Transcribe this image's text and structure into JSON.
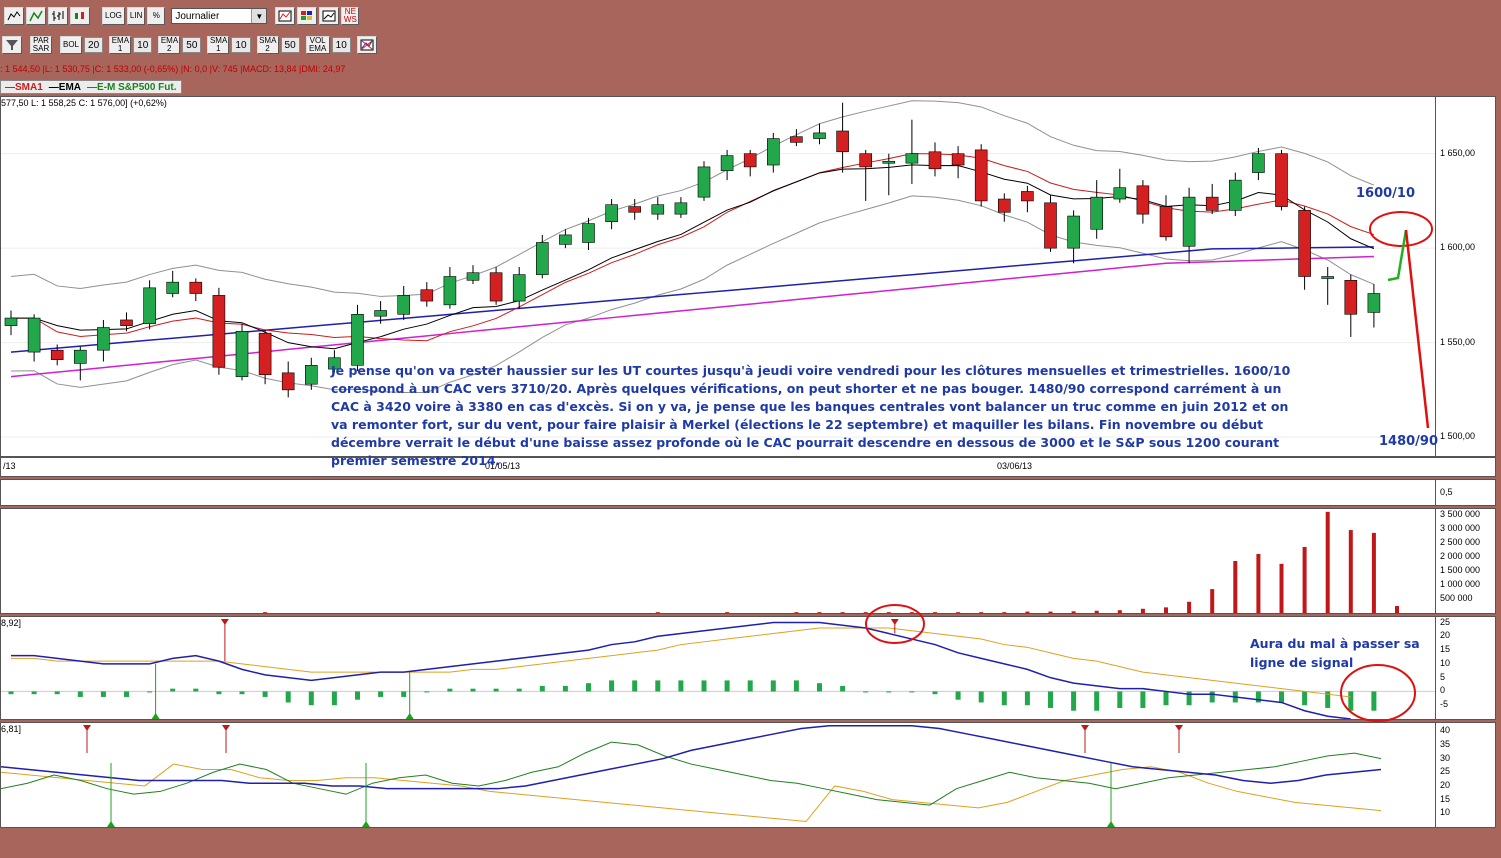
{
  "toolbar1": {
    "buttons": [
      {
        "id": "line-chart",
        "label": ""
      },
      {
        "id": "bar-chart",
        "label": ""
      },
      {
        "id": "ohlc-chart",
        "label": ""
      },
      {
        "id": "candle-chart",
        "label": ""
      }
    ],
    "log_label": "LOG",
    "lin_label": "LIN",
    "pct_label": "%",
    "period_value": "Journalier",
    "news_label": "NE WS"
  },
  "toolbar2": {
    "par_sar": "PAR SAR",
    "bol": "BOL",
    "bol_val": "20",
    "ema1": "EMA 1",
    "ema1_val": "10",
    "ema2": "EMA 2",
    "ema2_val": "50",
    "sma1": "SMA 1",
    "sma1_val": "10",
    "sma2": "SMA 2",
    "sma2_val": "50",
    "vol_ema": "VOL EMA",
    "vol_ema_val": "10"
  },
  "infobar": ": 1 544,50 |L: 1 530,75 |C: 1 533,00 (-0,65%) |N: 0,0 |V: 745 |MACD: 13,84 |DMI: 24,97",
  "legend": {
    "sma1": "SMA1",
    "ema": "EMA",
    "em": "E-M S&P500 Fut."
  },
  "colors": {
    "up": "#22a84a",
    "down": "#d42020",
    "ema": "#000000",
    "sma": "#cc1c1c",
    "ma50": "#1f1fb0",
    "ma50b": "#d020d0",
    "bollinger": "#909090",
    "macd": "#1f1fb0",
    "signal": "#e0a020",
    "annot": "#1f3aa8",
    "circle": "#e01010"
  },
  "price_panel": {
    "title": "577,50   L: 1 558,25   C: 1 576,00] (+0,62%)"
  },
  "dates": [
    "/13",
    "01/05/13",
    "03/06/13"
  ],
  "annotations": {
    "text": "Je pense qu'on va rester haussier sur les UT courtes jusqu'à jeudi voire vendredi pour les clôtures mensuelles et trimestrielles. 1600/10 corespond à un CAC vers 3710/20. Après quelques vérifications, on peut shorter et ne pas bouger. 1480/90 correspond carrément à un CAC à 3420 voire à 3380 en cas d'excès. Si on y va, je pense que les banques centrales vont balancer un truc comme en juin 2012 et on va remonter fort, sur du vent, pour faire plaisir à Merkel (élections le 22 septembre) et maquiller les bilans. Fin novembre ou début décembre verrait le début d'une baisse assez profonde où le CAC pourrait descendre en dessous de 3000 et le S&P sous 1200 courant premier semestre 2014.",
    "target_high": "1600/10",
    "target_low": "1480/90",
    "macd_note": "Aura du mal à passer sa ligne de signal"
  },
  "macd_panel": {
    "title": "8,92]"
  },
  "dmi_panel": {
    "title": "6,81]"
  },
  "chart_data": [
    {
      "type": "candlestick",
      "name": "price",
      "ylim": [
        1490,
        1680
      ],
      "yticks": [
        "1 650,00",
        "1 600,00",
        "1 550,00",
        "1 500,00"
      ],
      "ytick_values": [
        1650,
        1600,
        1550,
        1500
      ],
      "ohlc": [
        [
          1559,
          1563,
          1554,
          1567
        ],
        [
          1545,
          1563,
          1540,
          1565
        ],
        [
          1546,
          1541,
          1538,
          1549
        ],
        [
          1539,
          1546,
          1530,
          1548
        ],
        [
          1546,
          1558,
          1540,
          1562
        ],
        [
          1562,
          1559,
          1556,
          1566
        ],
        [
          1560,
          1579,
          1557,
          1583
        ],
        [
          1576,
          1582,
          1574,
          1588
        ],
        [
          1582,
          1576,
          1572,
          1584
        ],
        [
          1575,
          1537,
          1533,
          1579
        ],
        [
          1532,
          1556,
          1530,
          1560
        ],
        [
          1555,
          1533,
          1528,
          1557
        ],
        [
          1534,
          1525,
          1521,
          1540
        ],
        [
          1528,
          1538,
          1525,
          1542
        ],
        [
          1536,
          1542,
          1534,
          1546
        ],
        [
          1538,
          1565,
          1535,
          1570
        ],
        [
          1564,
          1567,
          1560,
          1572
        ],
        [
          1565,
          1575,
          1562,
          1580
        ],
        [
          1578,
          1572,
          1569,
          1582
        ],
        [
          1570,
          1585,
          1568,
          1590
        ],
        [
          1583,
          1587,
          1581,
          1591
        ],
        [
          1587,
          1572,
          1570,
          1590
        ],
        [
          1572,
          1586,
          1568,
          1590
        ],
        [
          1586,
          1603,
          1584,
          1607
        ],
        [
          1602,
          1607,
          1600,
          1610
        ],
        [
          1603,
          1613,
          1599,
          1616
        ],
        [
          1614,
          1623,
          1610,
          1626
        ],
        [
          1622,
          1619,
          1615,
          1626
        ],
        [
          1618,
          1623,
          1615,
          1627
        ],
        [
          1618,
          1624,
          1616,
          1627
        ],
        [
          1627,
          1643,
          1625,
          1646
        ],
        [
          1641,
          1649,
          1636,
          1652
        ],
        [
          1650,
          1643,
          1638,
          1652
        ],
        [
          1644,
          1658,
          1640,
          1661
        ],
        [
          1659,
          1656,
          1654,
          1663
        ],
        [
          1658,
          1661,
          1655,
          1666
        ],
        [
          1662,
          1651,
          1640,
          1677
        ],
        [
          1650,
          1643,
          1625,
          1652
        ],
        [
          1646,
          1646,
          1628,
          1650
        ],
        [
          1645,
          1650,
          1634,
          1668
        ],
        [
          1651,
          1642,
          1638,
          1656
        ],
        [
          1650,
          1644,
          1637,
          1654
        ],
        [
          1652,
          1625,
          1622,
          1655
        ],
        [
          1626,
          1619,
          1614,
          1629
        ],
        [
          1630,
          1625,
          1619,
          1633
        ],
        [
          1624,
          1600,
          1598,
          1628
        ],
        [
          1600,
          1617,
          1592,
          1620
        ],
        [
          1610,
          1627,
          1605,
          1636
        ],
        [
          1626,
          1632,
          1624,
          1642
        ],
        [
          1633,
          1618,
          1613,
          1636
        ],
        [
          1622,
          1606,
          1604,
          1628
        ],
        [
          1601,
          1627,
          1592,
          1632
        ],
        [
          1627,
          1620,
          1618,
          1634
        ],
        [
          1620,
          1636,
          1617,
          1640
        ],
        [
          1640,
          1650,
          1636,
          1653
        ],
        [
          1650,
          1622,
          1620,
          1652
        ],
        [
          1620,
          1585,
          1578,
          1622
        ],
        [
          1585,
          1585,
          1570,
          1590
        ],
        [
          1583,
          1565,
          1553,
          1586
        ],
        [
          1566,
          1576,
          1558,
          1581
        ]
      ]
    },
    {
      "type": "bar",
      "name": "volume",
      "ylim": [
        0,
        3700000
      ],
      "yticks": [
        "3 500 000",
        "3 000 000",
        "2 500 000",
        "2 000 000",
        "1 500 000",
        "1 000 000",
        "500 000"
      ],
      "ytick_values": [
        3500000,
        3000000,
        2500000,
        2000000,
        1500000,
        1000000,
        500000
      ],
      "values": [
        0,
        0,
        0,
        0,
        0,
        0,
        0,
        0,
        0,
        0,
        0,
        30000,
        0,
        0,
        0,
        0,
        0,
        0,
        0,
        0,
        0,
        0,
        0,
        0,
        0,
        0,
        0,
        0,
        30000,
        0,
        0,
        30000,
        0,
        0,
        30000,
        30000,
        30000,
        30000,
        30000,
        30000,
        30000,
        30000,
        30000,
        30000,
        50000,
        50000,
        60000,
        80000,
        100000,
        150000,
        200000,
        400000,
        850000,
        1850000,
        2100000,
        1750000,
        2350000,
        3600000,
        2950000,
        2850000,
        250000
      ]
    },
    {
      "type": "line",
      "name": "macd",
      "ylim": [
        -10,
        27
      ],
      "yticks": [
        "25",
        "20",
        "15",
        "10",
        "5",
        "0",
        "-5"
      ],
      "ytick_values": [
        25,
        20,
        15,
        10,
        5,
        0,
        -5
      ],
      "macd": [
        13,
        13,
        12,
        11,
        10,
        10,
        10,
        12,
        13,
        11,
        8,
        6,
        5,
        4,
        5,
        6,
        7,
        7,
        8,
        9,
        10,
        11,
        12,
        13,
        14,
        15,
        17,
        18,
        20,
        21,
        22,
        23,
        24,
        25,
        25,
        25,
        24,
        23,
        21,
        19,
        17,
        14,
        12,
        10,
        8,
        5,
        3,
        2,
        1,
        1,
        0,
        -1,
        -1,
        -2,
        -3,
        -4,
        -7,
        -9,
        -10
      ],
      "signal": [
        12,
        12,
        11,
        11,
        11,
        11,
        11,
        11,
        11,
        11,
        10,
        9,
        8,
        7,
        7,
        7,
        7,
        7,
        7,
        7,
        8,
        8,
        9,
        10,
        11,
        12,
        13,
        14,
        15,
        17,
        18,
        19,
        20,
        21,
        22,
        23,
        23,
        23,
        23,
        22,
        21,
        20,
        19,
        17,
        16,
        14,
        12,
        11,
        9,
        7,
        6,
        5,
        4,
        3,
        2,
        1,
        0,
        -1,
        -2
      ],
      "hist": [
        -1,
        -1,
        -1,
        -2,
        -2,
        -2,
        0,
        1,
        1,
        -1,
        -1,
        -2,
        -4,
        -5,
        -5,
        -3,
        -2,
        -2,
        0,
        1,
        1,
        1,
        1,
        2,
        2,
        3,
        4,
        4,
        4,
        4,
        4,
        4,
        4,
        4,
        4,
        3,
        2,
        0,
        0,
        0,
        -1,
        -3,
        -4,
        -5,
        -5,
        -6,
        -7,
        -7,
        -6,
        -6,
        -5,
        -5,
        -4,
        -4,
        -4,
        -4,
        -5,
        -6,
        -7,
        -7
      ]
    },
    {
      "type": "line",
      "name": "dmi",
      "ylim": [
        5,
        43
      ],
      "yticks": [
        "40",
        "35",
        "30",
        "25",
        "20",
        "15",
        "10"
      ],
      "ytick_values": [
        40,
        35,
        30,
        25,
        20,
        15,
        10
      ],
      "adx": [
        27,
        26,
        25,
        24,
        23,
        22,
        22,
        22,
        22,
        21,
        21,
        21,
        20,
        20,
        19,
        19,
        19,
        19,
        19,
        20,
        22,
        24,
        26,
        28,
        30,
        33,
        35,
        37,
        39,
        41,
        42,
        42,
        42,
        42,
        41,
        39,
        37,
        35,
        33,
        31,
        29,
        27,
        26,
        25,
        24,
        22,
        21,
        22,
        24,
        25,
        26
      ],
      "plus_di": [
        19,
        21,
        24,
        22,
        19,
        17,
        18,
        21,
        25,
        28,
        26,
        21,
        19,
        17,
        21,
        23,
        24,
        21,
        20,
        22,
        25,
        27,
        32,
        36,
        35,
        31,
        28,
        26,
        24,
        22,
        21,
        19,
        17,
        15,
        14,
        13,
        19,
        22,
        25,
        23,
        22,
        21,
        19,
        21,
        23,
        24,
        25,
        26,
        27,
        29,
        31,
        32,
        30
      ],
      "minus_di": [
        25,
        24,
        23,
        22,
        21,
        20,
        28,
        26,
        26,
        23,
        22,
        22,
        23,
        23,
        22,
        21,
        20,
        18,
        17,
        16,
        15,
        14,
        13,
        12,
        11,
        10,
        9,
        8,
        7,
        20,
        18,
        15,
        14,
        13,
        12,
        14,
        18,
        22,
        24,
        26,
        27,
        25,
        21,
        18,
        16,
        14,
        13,
        12,
        11
      ]
    }
  ]
}
